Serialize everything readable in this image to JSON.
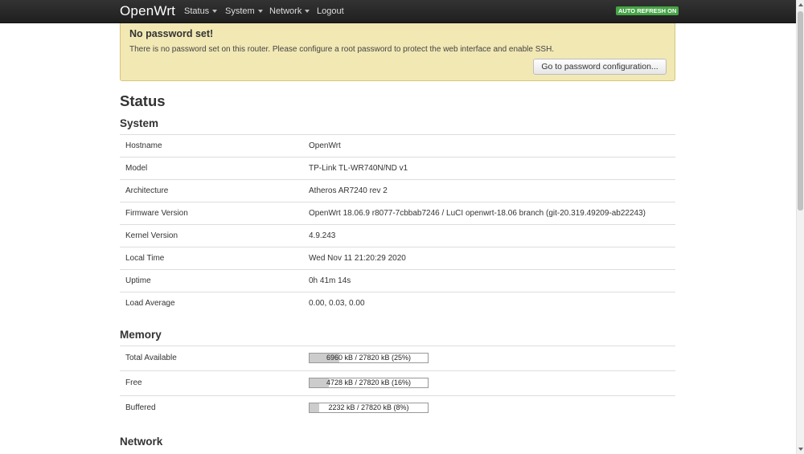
{
  "navbar": {
    "brand": "OpenWrt",
    "menu": [
      {
        "label": "Status",
        "dropdown": true
      },
      {
        "label": "System",
        "dropdown": true
      },
      {
        "label": "Network",
        "dropdown": true
      },
      {
        "label": "Logout",
        "dropdown": false
      }
    ],
    "auto_refresh": "AUTO REFRESH ON"
  },
  "alert": {
    "title": "No password set!",
    "text": "There is no password set on this router. Please configure a root password to protect the web interface and enable SSH.",
    "button_label": "Go to password configuration..."
  },
  "page_title": "Status",
  "system": {
    "title": "System",
    "rows": [
      {
        "label": "Hostname",
        "value": "OpenWrt"
      },
      {
        "label": "Model",
        "value": "TP-Link TL-WR740N/ND v1"
      },
      {
        "label": "Architecture",
        "value": "Atheros AR7240 rev 2"
      },
      {
        "label": "Firmware Version",
        "value": "OpenWrt 18.06.9 r8077-7cbbab7246 / LuCI openwrt-18.06 branch (git-20.319.49209-ab22243)"
      },
      {
        "label": "Kernel Version",
        "value": "4.9.243"
      },
      {
        "label": "Local Time",
        "value": "Wed Nov 11 21:20:29 2020"
      },
      {
        "label": "Uptime",
        "value": "0h 41m 14s"
      },
      {
        "label": "Load Average",
        "value": "0.00, 0.03, 0.00"
      }
    ]
  },
  "memory": {
    "title": "Memory",
    "rows": [
      {
        "label": "Total Available",
        "text": "6960 kB / 27820 kB (25%)",
        "percent": 25
      },
      {
        "label": "Free",
        "text": "4728 kB / 27820 kB (16%)",
        "percent": 16
      },
      {
        "label": "Buffered",
        "text": "2232 kB / 27820 kB (8%)",
        "percent": 8
      }
    ]
  },
  "network": {
    "title": "Network"
  },
  "colors": {
    "navbar": "#222222",
    "alert_bg": "#f1e8b4",
    "auto_refresh": "#46a546",
    "bar_fill": "#cccccc"
  }
}
